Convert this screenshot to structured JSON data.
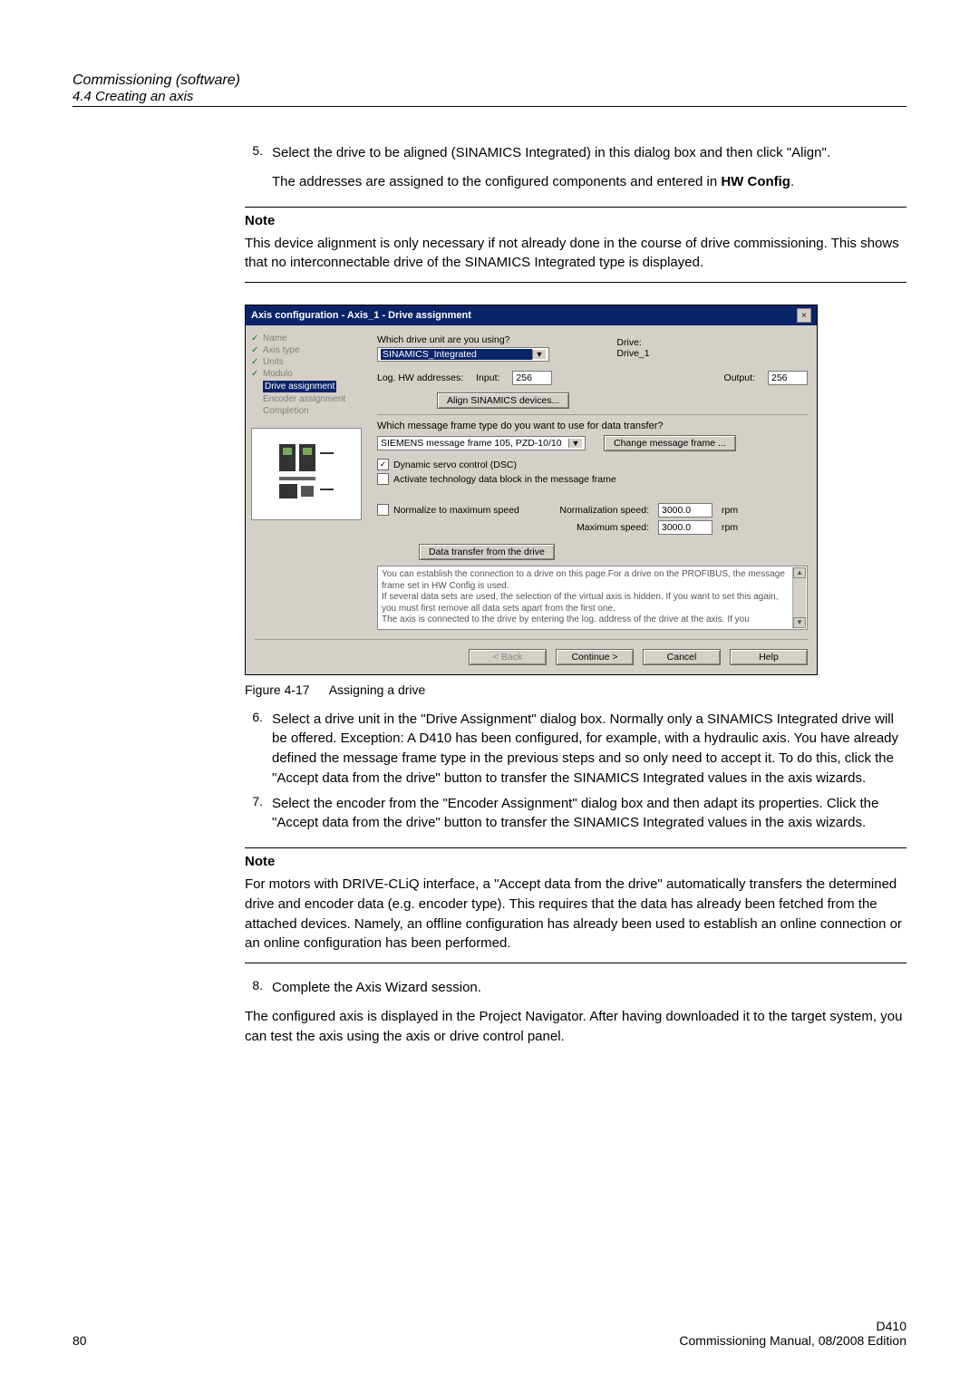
{
  "header": {
    "chapter": "Commissioning (software)",
    "section": "4.4 Creating an axis"
  },
  "steps": {
    "s5": {
      "num": "5.",
      "text_a": "Select the drive to be aligned (SINAMICS Integrated) in this dialog box and then click \"Align\".",
      "text_b_pre": "The addresses are assigned to the configured components and entered in ",
      "text_b_bold": "HW Config",
      "text_b_post": "."
    },
    "note1": {
      "label": "Note",
      "text": "This device alignment is only necessary if not already done in the course of drive commissioning. This shows that no interconnectable drive of the SINAMICS Integrated type is displayed."
    },
    "figcap": {
      "num": "Figure 4-17",
      "text": "Assigning a drive"
    },
    "s6": {
      "num": "6.",
      "text": "Select a drive unit in the \"Drive Assignment\" dialog box. Normally only a SINAMICS Integrated drive will be offered. Exception: A D410 has been configured, for example, with a hydraulic axis. You have already defined the message frame type in the previous steps and so only need to accept it. To do this, click the \"Accept data from the drive\" button to transfer the SINAMICS Integrated values in the axis wizards."
    },
    "s7": {
      "num": "7.",
      "text": "Select the encoder from the \"Encoder Assignment\" dialog box and then adapt its properties. Click the \"Accept data from the drive\" button to transfer the SINAMICS Integrated values in the axis wizards."
    },
    "note2": {
      "label": "Note",
      "text": "For motors with DRIVE-CLiQ interface, a \"Accept data from the drive\" automatically transfers the determined drive and encoder data (e.g. encoder type). This requires that the data has already been fetched from the attached devices. Namely, an offline configuration has already been used to establish an online connection or an online configuration has been performed."
    },
    "s8": {
      "num": "8.",
      "text": "Complete the Axis Wizard session."
    },
    "final": "The configured axis is displayed in the Project Navigator. After having downloaded it to the target system, you can test the axis using the axis or drive control panel."
  },
  "shot": {
    "title": "Axis configuration - Axis_1 - Drive assignment",
    "nav": {
      "items": [
        "Name",
        "Axis type",
        "Units",
        "Modulo",
        "Drive assignment",
        "Encoder assignment",
        "Completion"
      ]
    },
    "q_drive": "Which drive unit are you using?",
    "drive_sel": "SINAMICS_Integrated",
    "drive_lbl": "Drive:",
    "drive_val": "Drive_1",
    "log_lbl": "Log. HW addresses:",
    "in_lbl": "Input:",
    "in_val": "256",
    "out_lbl": "Output:",
    "out_val": "256",
    "btn_align": "Align SINAMICS devices...",
    "q_msg": "Which message frame type do you want to use for data transfer?",
    "msg_sel": "SIEMENS message frame 105, PZD-10/10",
    "btn_change": "Change message frame ...",
    "chk_dsc": "Dynamic servo control (DSC)",
    "chk_tech": "Activate technology data block in the message frame",
    "chk_norm": "Normalize to maximum speed",
    "norm_lbl": "Normalization speed:",
    "norm_val": "3000.0",
    "max_lbl": "Maximum speed:",
    "max_val": "3000.0",
    "rpm": "rpm",
    "btn_data": "Data transfer from the drive",
    "desc": "You can establish the connection to a drive on this page.For a drive on the PROFIBUS, the message frame set in HW Config is used.\nIf several data sets are used, the selection of the virtual axis is hidden. If you want to set this again, you must first remove all data sets apart from the first one.\nThe axis is connected to the drive by entering the log. address of the drive at the axis. If you",
    "btn_back": "< Back",
    "btn_cont": "Continue >",
    "btn_cancel": "Cancel",
    "btn_help": "Help"
  },
  "footer": {
    "page": "80",
    "r1": "D410",
    "r2": "Commissioning Manual, 08/2008 Edition"
  }
}
